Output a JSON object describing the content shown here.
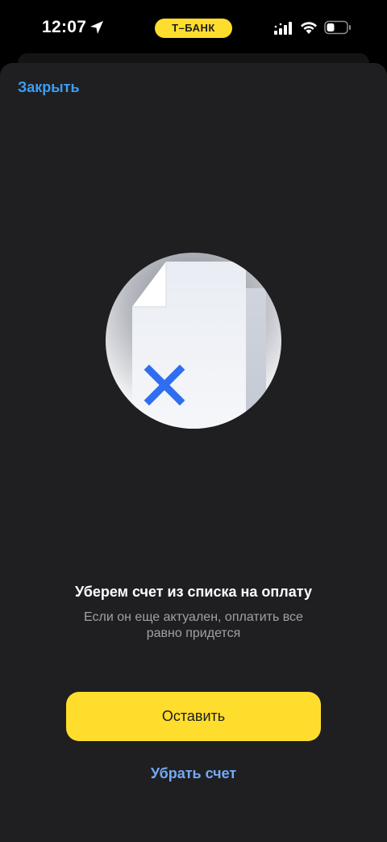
{
  "status_bar": {
    "time": "12:07",
    "bank_label": "Т–БАНК",
    "icons": [
      "location-arrow-icon",
      "cellular-signal-icon",
      "wifi-icon",
      "battery-icon"
    ]
  },
  "sheet": {
    "close_label": "Закрыть",
    "illustration_icon": "document-remove-icon",
    "title": "Уберем счет из списка на оплату",
    "subtitle": "Если он еще актуален, оплатить все равно придется",
    "primary_button_label": "Оставить",
    "secondary_link_label": "Убрать счет"
  },
  "colors": {
    "accent_yellow": "#ffdd2d",
    "link_blue": "#3b9ef5",
    "secondary_link_blue": "#74a9f5",
    "sheet_background": "#1f1f21",
    "x_mark_blue": "#2f6ef0"
  }
}
